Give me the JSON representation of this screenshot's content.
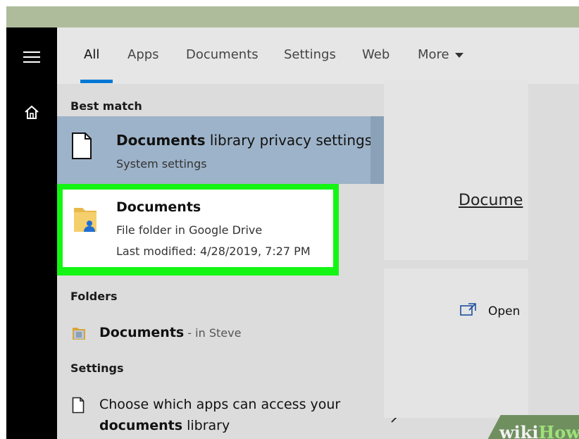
{
  "tabs": {
    "items": [
      {
        "label": "All",
        "active": true
      },
      {
        "label": "Apps"
      },
      {
        "label": "Documents"
      },
      {
        "label": "Settings"
      },
      {
        "label": "Web"
      },
      {
        "label": "More"
      }
    ]
  },
  "sections": {
    "best_match": "Best match",
    "folders": "Folders",
    "settings": "Settings"
  },
  "best_match": {
    "title_bold": "Documents",
    "title_rest": " library privacy settings",
    "subtitle": "System settings"
  },
  "highlighted": {
    "title": "Documents",
    "line1": "File folder in Google Drive",
    "line2": "Last modified: 4/28/2019, 7:27 PM"
  },
  "folders_item": {
    "name": "Documents",
    "location": " - in Steve"
  },
  "settings_item": {
    "line1": "Choose which apps can access your",
    "line2_bold": "documents",
    "line2_rest": " library"
  },
  "preview": {
    "title": "Docume",
    "open_label": "Open"
  },
  "watermark": {
    "part1": "wiki",
    "part2": "How"
  },
  "colors": {
    "accent": "#0078d4",
    "highlight": "#14f514",
    "best_match_bg": "#9db3c9"
  },
  "icons": [
    "hamburger-icon",
    "home-icon",
    "document-icon",
    "arrow-right-icon",
    "google-drive-folder-icon",
    "chevron-right-icon",
    "folder-icon",
    "page-icon",
    "open-icon",
    "caret-down-icon"
  ]
}
